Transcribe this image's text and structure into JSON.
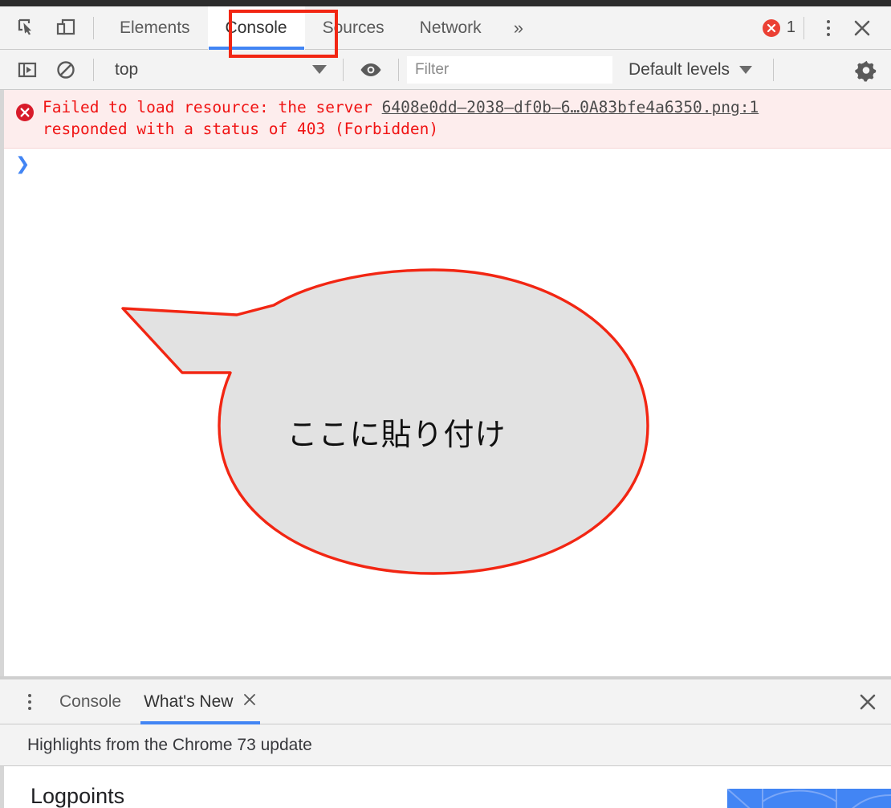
{
  "devtools": {
    "toolbar": {
      "inspect_icon": "inspect-element-icon",
      "device_icon": "device-toolbar-icon",
      "tabs": [
        {
          "label": "Elements",
          "selected": false
        },
        {
          "label": "Console",
          "selected": true
        },
        {
          "label": "Sources",
          "selected": false
        },
        {
          "label": "Network",
          "selected": false
        }
      ],
      "more_tabs_label": "»",
      "error_count": "1",
      "error_badge_icon": "error-circle-icon",
      "kebab_icon": "more-options-icon",
      "close_icon": "close-icon",
      "highlight_color": "#f22613",
      "accent_color": "#4285f4"
    },
    "console_toolbar": {
      "sidebar_toggle_icon": "console-sidebar-toggle-icon",
      "clear_icon": "clear-console-icon",
      "context_value": "top",
      "context_caret_icon": "chevron-down-icon",
      "eye_icon": "live-expression-eye-icon",
      "filter_value": "",
      "filter_placeholder": "Filter",
      "levels_label": "Default levels",
      "levels_caret_icon": "chevron-down-icon",
      "settings_icon": "gear-icon"
    },
    "console": {
      "error_icon": "error-circle-icon",
      "error_message_prefix": "Failed to load resource: the server ",
      "error_url": "6408e0dd–2038–df0b–6…0A83bfe4a6350.png:1",
      "error_message_suffix": "responded with a status of 403 (Forbidden)",
      "prompt_symbol": "❯",
      "error_text_color": "#f01414",
      "error_bg_color": "#fdeded"
    },
    "annotation": {
      "bubble_text": "ここに貼り付け",
      "bubble_fill": "#e2e2e2",
      "bubble_stroke": "#f22613"
    },
    "drawer": {
      "kebab_icon": "more-options-icon",
      "tabs": [
        {
          "label": "Console",
          "selected": false,
          "closable": false
        },
        {
          "label": "What's New",
          "selected": true,
          "closable": true
        }
      ],
      "tab_close_icon": "close-icon",
      "close_icon": "close-icon",
      "subtitle": "Highlights from the Chrome 73 update",
      "content_heading": "Logpoints"
    }
  }
}
